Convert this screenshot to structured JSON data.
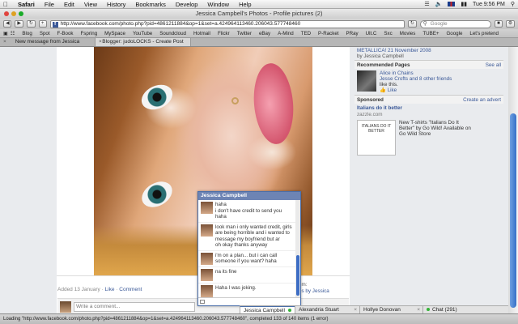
{
  "menubar": {
    "app": "Safari",
    "items": [
      "File",
      "Edit",
      "View",
      "History",
      "Bookmarks",
      "Develop",
      "Window",
      "Help"
    ],
    "clock": "Tue 9:56 PM"
  },
  "window": {
    "title": "Jessica Campbell's Photos - Profile pictures (2)"
  },
  "toolbar": {
    "url": "http://www.facebook.com/photo.php?pid=4861211884&op=1&set=a.424964113460.206043.577748460",
    "search_placeholder": "Google"
  },
  "bookmarks": [
    "Blog",
    "Spot",
    "F-Book",
    "Fspring",
    "MySpace",
    "YouTube",
    "Soundcloud",
    "Hotmail",
    "Flickr",
    "Twitter",
    "eBay",
    "A-Mind",
    "TED",
    "P-Racket",
    "PRay",
    "Ult.C",
    "Sxc",
    "Movies",
    "TUBE+",
    "Google",
    "Let's pretend"
  ],
  "tabs": [
    {
      "label": "New message from Jessica"
    },
    {
      "label": "Blogger: judoLOCKS - Create Post"
    }
  ],
  "photo_page": {
    "added": "Added 13 January",
    "like": "Like",
    "comment": "Comment",
    "comment_placeholder": "Write a comment...",
    "album_line1": "um:",
    "album_line2": "es by Jessica"
  },
  "sidebar": {
    "prev_title": "METALLICA! 21 November 2008",
    "prev_by": "by Jessica Campbell",
    "recommended_title": "Recommended Pages",
    "see_all": "See all",
    "rec_name": "Alice in Chains",
    "rec_friends": "Jesse Crofts and 8 other friends",
    "rec_likes": "like this.",
    "rec_like_btn": "Like",
    "sponsored_title": "Sponsored",
    "create_ad": "Create an advert",
    "ad_title": "Italians do it better",
    "ad_url": "zazzle.com",
    "ad_img_text": "ITALIANS DO IT BETTER",
    "ad_text": "New T-shirts \"Italians Do It Better\" by Go Wild! Available on Go Wild Store"
  },
  "chat": {
    "name": "Jessica Campbell",
    "messages": [
      {
        "lines": "haha\ni don't have credit to send you haha"
      },
      {
        "lines": "look man i only wanted credit, girls are being horrible and i wanted to message my boyfriend but ar\noh okay thanks anyway"
      },
      {
        "lines": "i'm on a plan... but i can call someone if you want? haha"
      },
      {
        "lines": "na its fine"
      },
      {
        "lines": "Haha I was joking."
      }
    ]
  },
  "chatbar": {
    "items": [
      {
        "label": "Jessica Campbell"
      },
      {
        "label": "Alexandria Stuart"
      },
      {
        "label": "Hollye Donovan"
      },
      {
        "label": "Chat (291)"
      }
    ]
  },
  "status": "Loading \"http://www.facebook.com/photo.php?pid=4861211884&op=1&set=a.424964113460.206043.577748460\", completed 133 of 140 items (1 error)"
}
